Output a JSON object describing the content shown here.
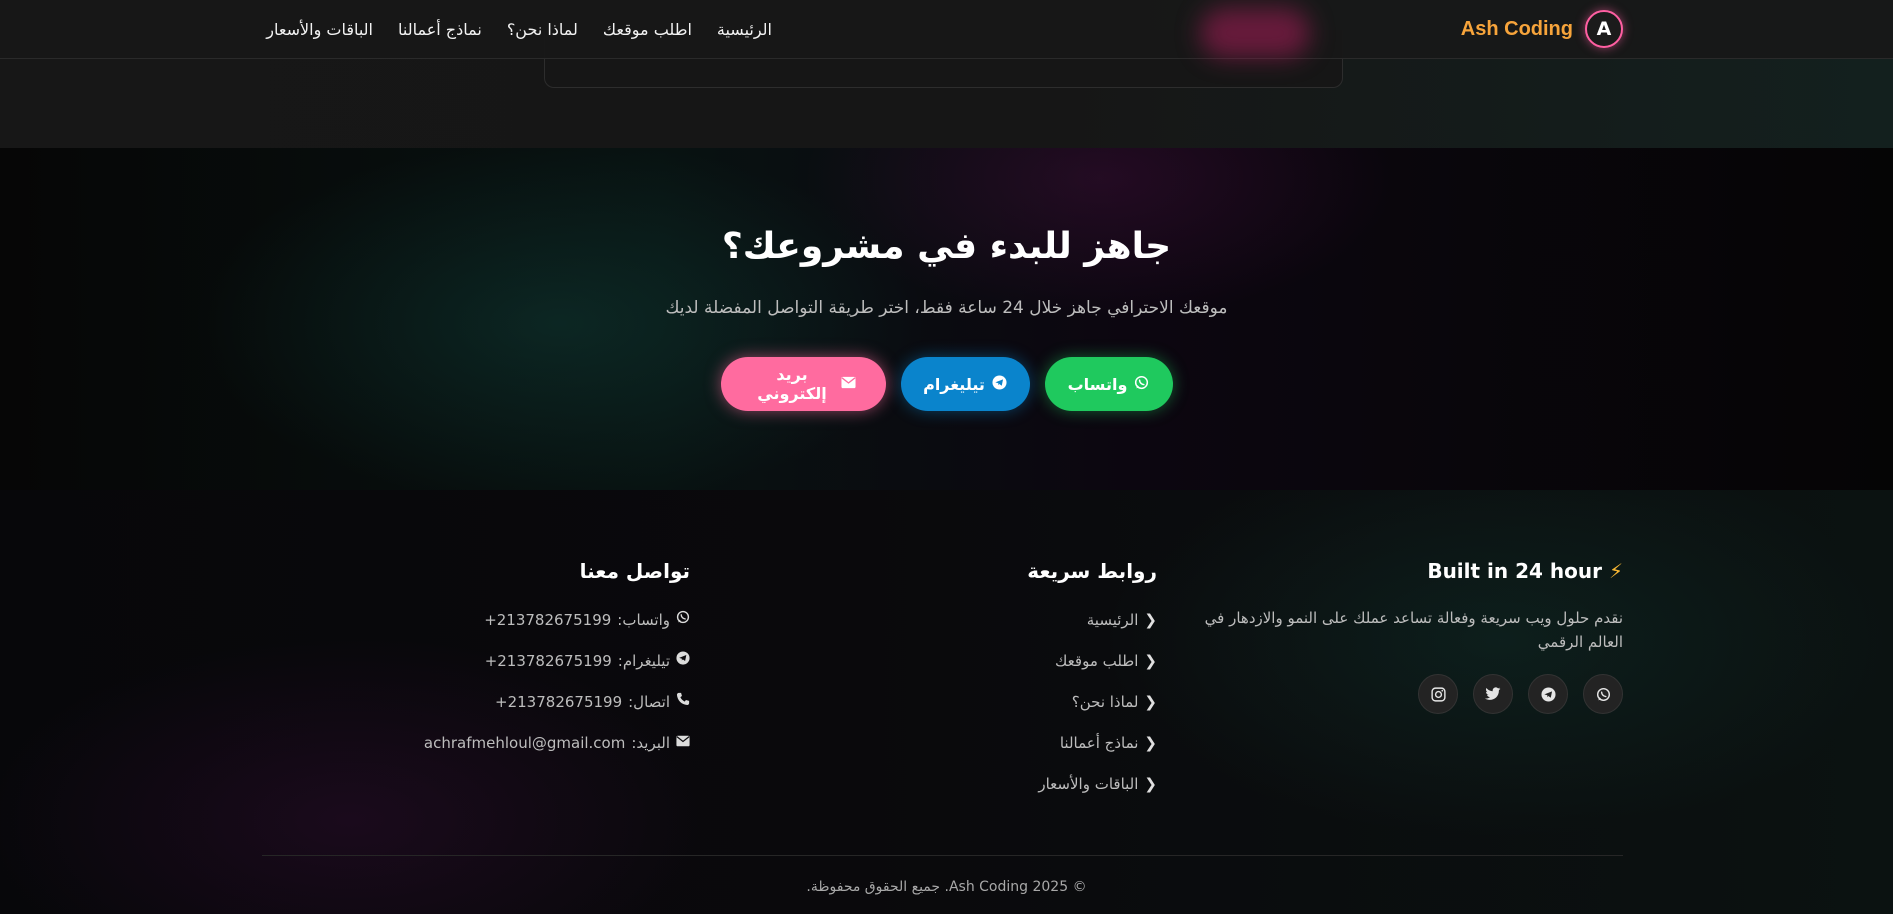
{
  "brand": {
    "name": "Ash Coding",
    "logo_letter": "A"
  },
  "nav": {
    "items": [
      {
        "label": "الرئيسية"
      },
      {
        "label": "اطلب موقعك"
      },
      {
        "label": "لماذا نحن؟"
      },
      {
        "label": "نماذج أعمالنا"
      },
      {
        "label": "الباقات والأسعار"
      }
    ]
  },
  "cta": {
    "title": "جاهز للبدء في مشروعك؟",
    "subtitle": "موقعك الاحترافي جاهز خلال 24 ساعة فقط، اختر طريقة التواصل المفضلة لديك",
    "buttons": {
      "whatsapp": {
        "label": "واتساب",
        "icon": "whatsapp-icon",
        "color": "#1fc95e"
      },
      "telegram": {
        "label": "تيليغرام",
        "icon": "telegram-icon",
        "color": "#0a84cc"
      },
      "email": {
        "label": "بريد إلكتروني",
        "icon": "envelope-icon",
        "color": "#ff6b9f"
      }
    }
  },
  "footer": {
    "about": {
      "title": "Built in 24 hour",
      "bolt_icon": "⚡",
      "text": "نقدم حلول ويب سريعة وفعالة تساعد عملك على النمو والازدهار في العالم الرقمي",
      "socials": [
        "whatsapp-icon",
        "telegram-icon",
        "twitter-icon",
        "instagram-icon"
      ]
    },
    "links": {
      "title": "روابط سريعة",
      "items": [
        {
          "label": "الرئيسية"
        },
        {
          "label": "اطلب موقعك"
        },
        {
          "label": "لماذا نحن؟"
        },
        {
          "label": "نماذج أعمالنا"
        },
        {
          "label": "الباقات والأسعار"
        }
      ]
    },
    "contact": {
      "title": "تواصل معنا",
      "items": [
        {
          "label": "واتساب:",
          "value": "+213782675199",
          "icon": "whatsapp-icon"
        },
        {
          "label": "تيليغرام:",
          "value": "+213782675199",
          "icon": "telegram-icon"
        },
        {
          "label": "اتصال:",
          "value": "+213782675199",
          "icon": "phone-icon"
        },
        {
          "label": "البريد:",
          "value": "achrafmehloul@gmail.com",
          "icon": "envelope-icon"
        }
      ]
    },
    "copyright": "© 2025 Ash Coding. جميع الحقوق محفوظة."
  },
  "colors": {
    "accent_orange": "#f7a43b",
    "accent_pink": "#ff5fa2",
    "whatsapp_green": "#1fc95e",
    "telegram_blue": "#0a84cc",
    "email_pink": "#ff6b9f"
  }
}
